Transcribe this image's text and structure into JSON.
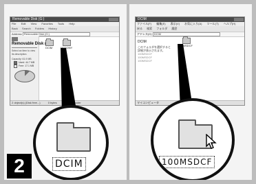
{
  "step_number": "2",
  "left": {
    "title": "Removable Disk (G:)",
    "menu": [
      "File",
      "Edit",
      "View",
      "Favorites",
      "Tools",
      "Help"
    ],
    "toolbar": [
      "Back",
      "Search",
      "Folders",
      "History"
    ],
    "address_label": "Address",
    "address_value": "Removable Disk (G:)",
    "pane_title": "Removable Disk (G:)",
    "pane_text": "Select an item to view its description.",
    "capacity": "Capacity: 61.9 MB",
    "used": "Used: 44.7 MB",
    "free": "Free: 17.1 MB",
    "folders": [
      "DCIM",
      "MSSONY"
    ],
    "status": [
      "2 object(s) (Disk free...)",
      "0 bytes",
      "My Computer"
    ],
    "magnified_label": "DCIM"
  },
  "right": {
    "title": "DCIM",
    "menu": [
      "ファイル(F)",
      "編集(E)",
      "表示(V)",
      "お気に入り(A)",
      "ツール(T)",
      "ヘルプ(H)"
    ],
    "toolbar": [
      "戻る",
      "検索",
      "フォルダ",
      "履歴"
    ],
    "address_label": "アドレス(D)",
    "address_value": "DCIM",
    "folder_small_label": "100MSDCF",
    "list_heading": "DCIM",
    "list_lines": [
      "このフォルダを選択すると",
      "詳細が表示されます。",
      "",
      "100MSDCF",
      "100MSDCF",
      "100MSDCF"
    ],
    "status": [
      "マイコンピュータ"
    ],
    "magnified_label": "100MSDCF"
  }
}
